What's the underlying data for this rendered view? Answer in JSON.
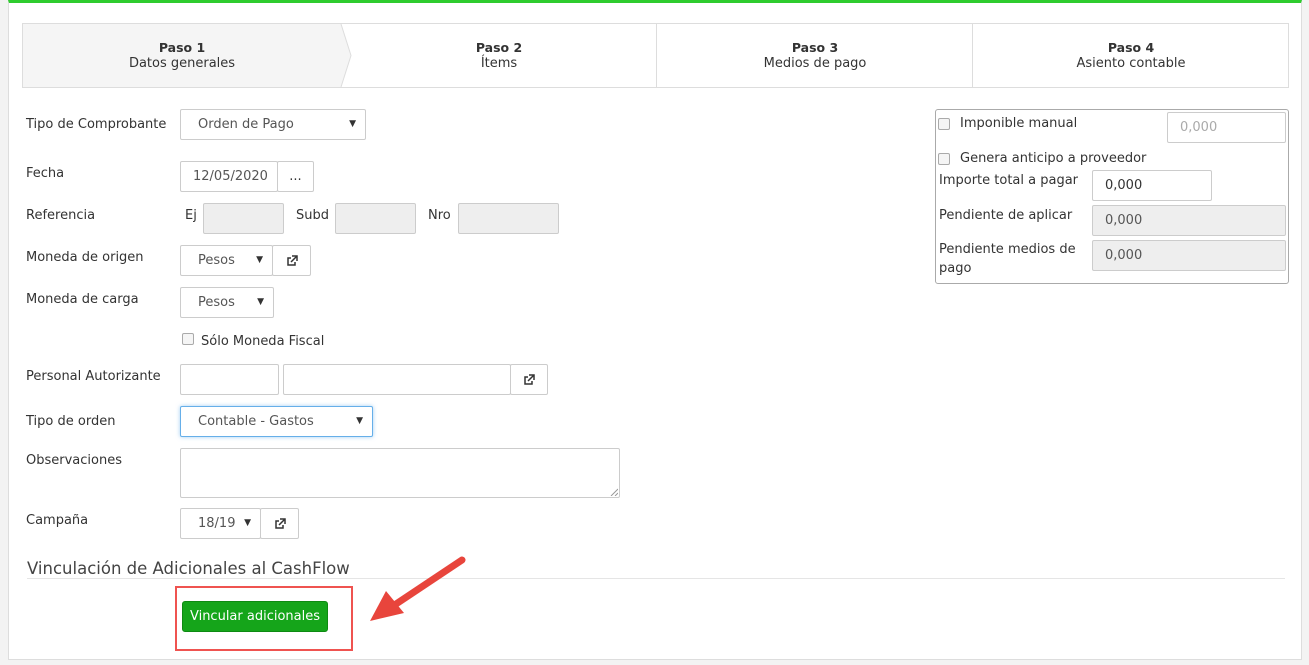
{
  "wizard": {
    "steps": [
      {
        "title": "Paso 1",
        "subtitle": "Datos generales"
      },
      {
        "title": "Paso 2",
        "subtitle": "Ítems"
      },
      {
        "title": "Paso 3",
        "subtitle": "Medios de pago"
      },
      {
        "title": "Paso 4",
        "subtitle": "Asiento contable"
      }
    ]
  },
  "form": {
    "tipo_comprobante": {
      "label": "Tipo de Comprobante",
      "value": "Orden de Pago"
    },
    "fecha": {
      "label": "Fecha",
      "value": "12/05/2020",
      "button": "..."
    },
    "referencia": {
      "label": "Referencia",
      "ej": "Ej",
      "subd": "Subd",
      "nro": "Nro"
    },
    "moneda_origen": {
      "label": "Moneda de origen",
      "value": "Pesos"
    },
    "moneda_carga": {
      "label": "Moneda de carga",
      "value": "Pesos"
    },
    "solo_moneda_fiscal": {
      "label": "Sólo Moneda Fiscal"
    },
    "personal_autorizante": {
      "label": "Personal Autorizante"
    },
    "tipo_orden": {
      "label": "Tipo de orden",
      "value": "Contable - Gastos"
    },
    "observaciones": {
      "label": "Observaciones"
    },
    "campana": {
      "label": "Campaña",
      "value": "18/19"
    }
  },
  "summary": {
    "imponible_manual": {
      "label": "Imponible manual",
      "value": "0,000"
    },
    "genera_anticipo": {
      "label": "Genera anticipo a proveedor"
    },
    "importe_total": {
      "label": "Importe total a pagar",
      "value": "0,000"
    },
    "pendiente_aplicar": {
      "label": "Pendiente de aplicar",
      "value": "0,000"
    },
    "pendiente_medios": {
      "label_line1": "Pendiente medios de",
      "label_line2": "pago",
      "value": "0,000"
    }
  },
  "vinculacion": {
    "title": "Vinculación de Adicionales al CashFlow",
    "button": "Vincular adicionales"
  },
  "icons": {
    "external_link": "external-link-icon",
    "caret": "caret-down-icon",
    "annotation": "red-arrow-annotation"
  },
  "colors": {
    "top_bar": "#2ecc2e",
    "primary_button": "#15a51a",
    "annotation": "#ef5350"
  }
}
